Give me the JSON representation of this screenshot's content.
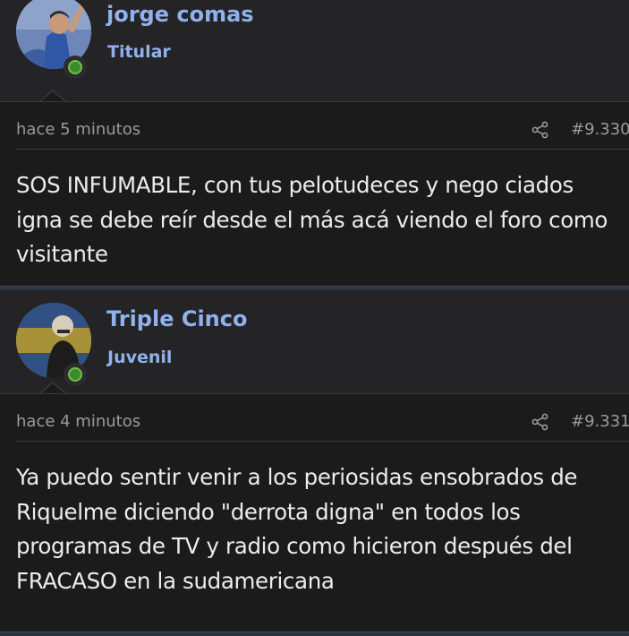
{
  "posts": [
    {
      "username": "jorge comas",
      "rank": "Titular",
      "time": "hace 5 minutos",
      "number": "#9.330",
      "text": "SOS INFUMABLE, con tus pelotudeces y nego ciados igna se debe reír desde el más acá viendo el foro como visitante",
      "avatar_colors": {
        "bg": "#4a5f8f",
        "accent": "#d9c2a0"
      }
    },
    {
      "username": "Triple Cinco",
      "rank": "Juvenil",
      "time": "hace 4 minutos",
      "number": "#9.331",
      "text": "Ya puedo sentir venir a los periosidas ensobrados de Riquelme diciendo \"derrota digna\" en todos los programas de TV y radio como hicieron después del FRACASO en la sudamericana",
      "avatar_colors": {
        "top": "#2b5fa8",
        "band": "#e2c23a",
        "bottom": "#2b5fa8"
      }
    }
  ],
  "icons": {
    "share": "share-icon",
    "online": "online-status-icon"
  },
  "colors": {
    "username": "#8fb2ee",
    "online": "#3d8b2e",
    "background": "#1b1b1c",
    "header": "#242426"
  }
}
